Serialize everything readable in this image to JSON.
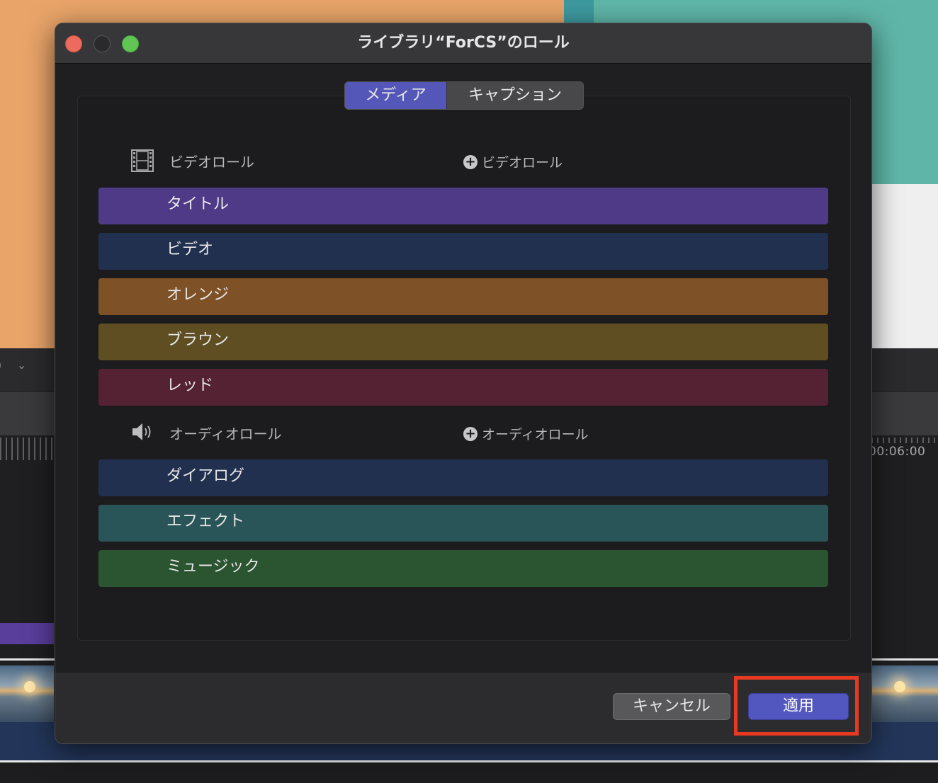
{
  "background": {
    "toolbar_paren": ")",
    "toolbar_chevron": "⌄",
    "timecode": "00:06:00"
  },
  "dialog": {
    "title": "ライブラリ“ForCS”のロール",
    "tabs": [
      {
        "label": "メディア",
        "selected": true
      },
      {
        "label": "キャプション",
        "selected": false
      }
    ],
    "video_section": {
      "label": "ビデオロール",
      "icon": "film-icon",
      "add_label": "ビデオロール"
    },
    "video_roles": [
      {
        "label": "タイトル",
        "color": "#4e3a87"
      },
      {
        "label": "ビデオ",
        "color": "#22304f"
      },
      {
        "label": "オレンジ",
        "color": "#7e5226"
      },
      {
        "label": "ブラウン",
        "color": "#5e4e22"
      },
      {
        "label": "レッド",
        "color": "#552233"
      }
    ],
    "audio_section": {
      "label": "オーディオロール",
      "icon": "speaker-icon",
      "add_label": "オーディオロール"
    },
    "audio_roles": [
      {
        "label": "ダイアログ",
        "color": "#22304f"
      },
      {
        "label": "エフェクト",
        "color": "#2a5558"
      },
      {
        "label": "ミュージック",
        "color": "#2b5430"
      }
    ],
    "buttons": {
      "cancel": "キャンセル",
      "apply": "適用"
    },
    "accent_color": "#5256bf",
    "highlight_color": "#e83a23"
  }
}
